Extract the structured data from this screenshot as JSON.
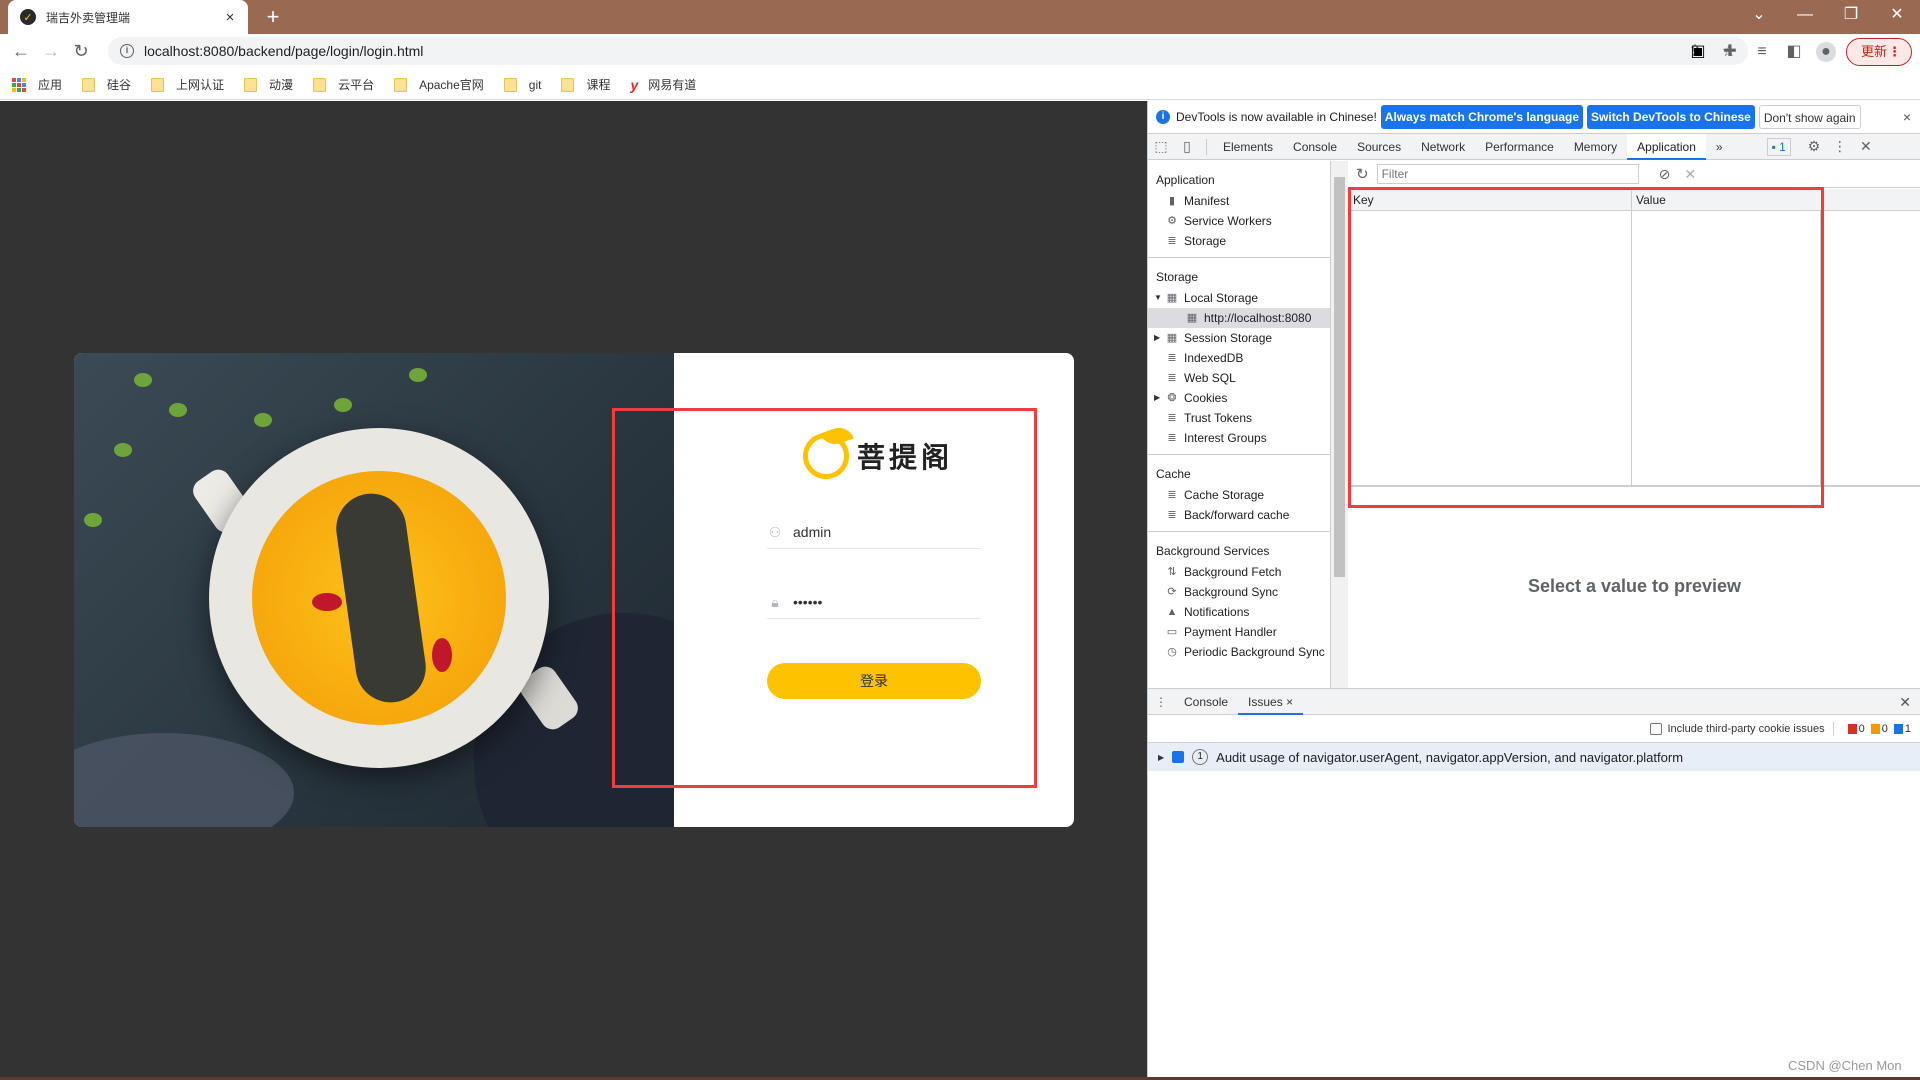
{
  "browser": {
    "tab_title": "瑞吉外卖管理端",
    "tab_close": "×",
    "new_tab": "+",
    "url": "localhost:8080/backend/page/login/login.html",
    "update_label": "更新",
    "window": {
      "dropdown": "⌄",
      "minimize": "—",
      "restore": "❐",
      "close": "✕"
    },
    "bookmarks": [
      {
        "label": "应用",
        "icon": "apps-grid-icon"
      },
      {
        "label": "硅谷",
        "icon": "folder-icon"
      },
      {
        "label": "上网认证",
        "icon": "folder-icon"
      },
      {
        "label": "动漫",
        "icon": "folder-icon"
      },
      {
        "label": "云平台",
        "icon": "folder-icon"
      },
      {
        "label": "Apache官网",
        "icon": "folder-icon"
      },
      {
        "label": "git",
        "icon": "folder-icon"
      },
      {
        "label": "课程",
        "icon": "folder-icon"
      },
      {
        "label": "网易有道",
        "icon": "youdao-icon"
      }
    ]
  },
  "login": {
    "brand_name": "菩提阁",
    "username_value": "admin",
    "password_value": "••••••",
    "login_button": "登录"
  },
  "devtools": {
    "infobar": {
      "message": "DevTools is now available in Chinese!",
      "btn_match": "Always match Chrome's language",
      "btn_switch": "Switch DevTools to Chinese",
      "btn_dont_show": "Don't show again",
      "close": "×"
    },
    "tabs": [
      "Elements",
      "Console",
      "Sources",
      "Network",
      "Performance",
      "Memory",
      "Application"
    ],
    "active_tab": "Application",
    "more_tabs": "»",
    "issues_badge": "1",
    "sidebar": {
      "application": {
        "header": "Application",
        "items": [
          "Manifest",
          "Service Workers",
          "Storage"
        ]
      },
      "storage": {
        "header": "Storage",
        "items": [
          "Local Storage",
          "http://localhost:8080",
          "Session Storage",
          "IndexedDB",
          "Web SQL",
          "Cookies",
          "Trust Tokens",
          "Interest Groups"
        ]
      },
      "cache": {
        "header": "Cache",
        "items": [
          "Cache Storage",
          "Back/forward cache"
        ]
      },
      "background": {
        "header": "Background Services",
        "items": [
          "Background Fetch",
          "Background Sync",
          "Notifications",
          "Payment Handler",
          "Periodic Background Sync"
        ]
      }
    },
    "filter_placeholder": "Filter",
    "table": {
      "columns": [
        "Key",
        "Value"
      ],
      "rows": []
    },
    "preview_text": "Select a value to preview",
    "drawer": {
      "tabs": [
        "Console",
        "Issues"
      ],
      "active_tab": "Issues",
      "tab_close": "×",
      "third_party_label": "Include third-party cookie issues",
      "counts": {
        "errors": "0",
        "warnings": "0",
        "info": "1"
      },
      "issue": {
        "count": "1",
        "text": "Audit usage of navigator.userAgent, navigator.appVersion, and navigator.platform"
      }
    }
  },
  "watermark": "CSDN @Chen Mon",
  "colors": {
    "accent": "#ffc200",
    "devtools_blue": "#1a73e8",
    "highlight_red": "#f03c3c",
    "titlebar": "#9a6951"
  }
}
